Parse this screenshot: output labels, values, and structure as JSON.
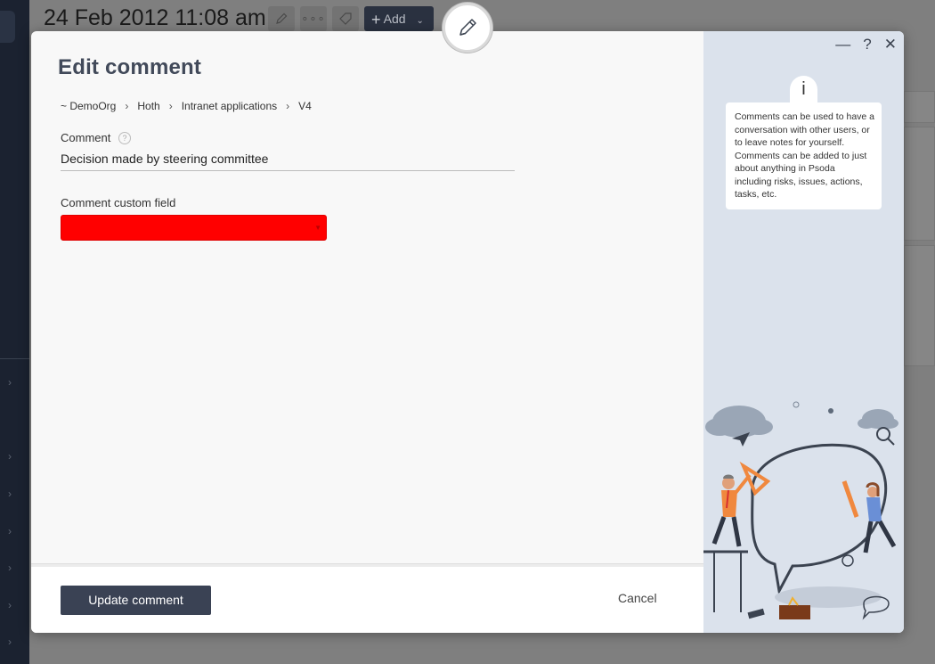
{
  "background": {
    "title": "24 Feb 2012 11:08 am",
    "toolbar": {
      "add_label": "Add"
    }
  },
  "modal": {
    "title": "Edit comment",
    "breadcrumb": [
      "~ DemoOrg",
      "Hoth",
      "Intranet applications",
      "V4"
    ],
    "fields": {
      "comment": {
        "label": "Comment",
        "help": "?",
        "value": "Decision made by steering committee"
      },
      "custom": {
        "label": "Comment custom field",
        "value": "",
        "color": "#ff0000"
      }
    },
    "buttons": {
      "update": "Update comment",
      "cancel": "Cancel"
    },
    "window_controls": {
      "minimize": "—",
      "help": "?",
      "close": "✕"
    },
    "info": {
      "icon": "i",
      "text": "Comments can be used to have a conversation with other users, or to leave notes for yourself. Comments can be added to just about anything in Psoda including risks, issues, actions, tasks, etc."
    }
  },
  "colors": {
    "primary_button": "#3a4254",
    "side_panel": "#dbe2ec",
    "accent_orange": "#f0883e"
  }
}
